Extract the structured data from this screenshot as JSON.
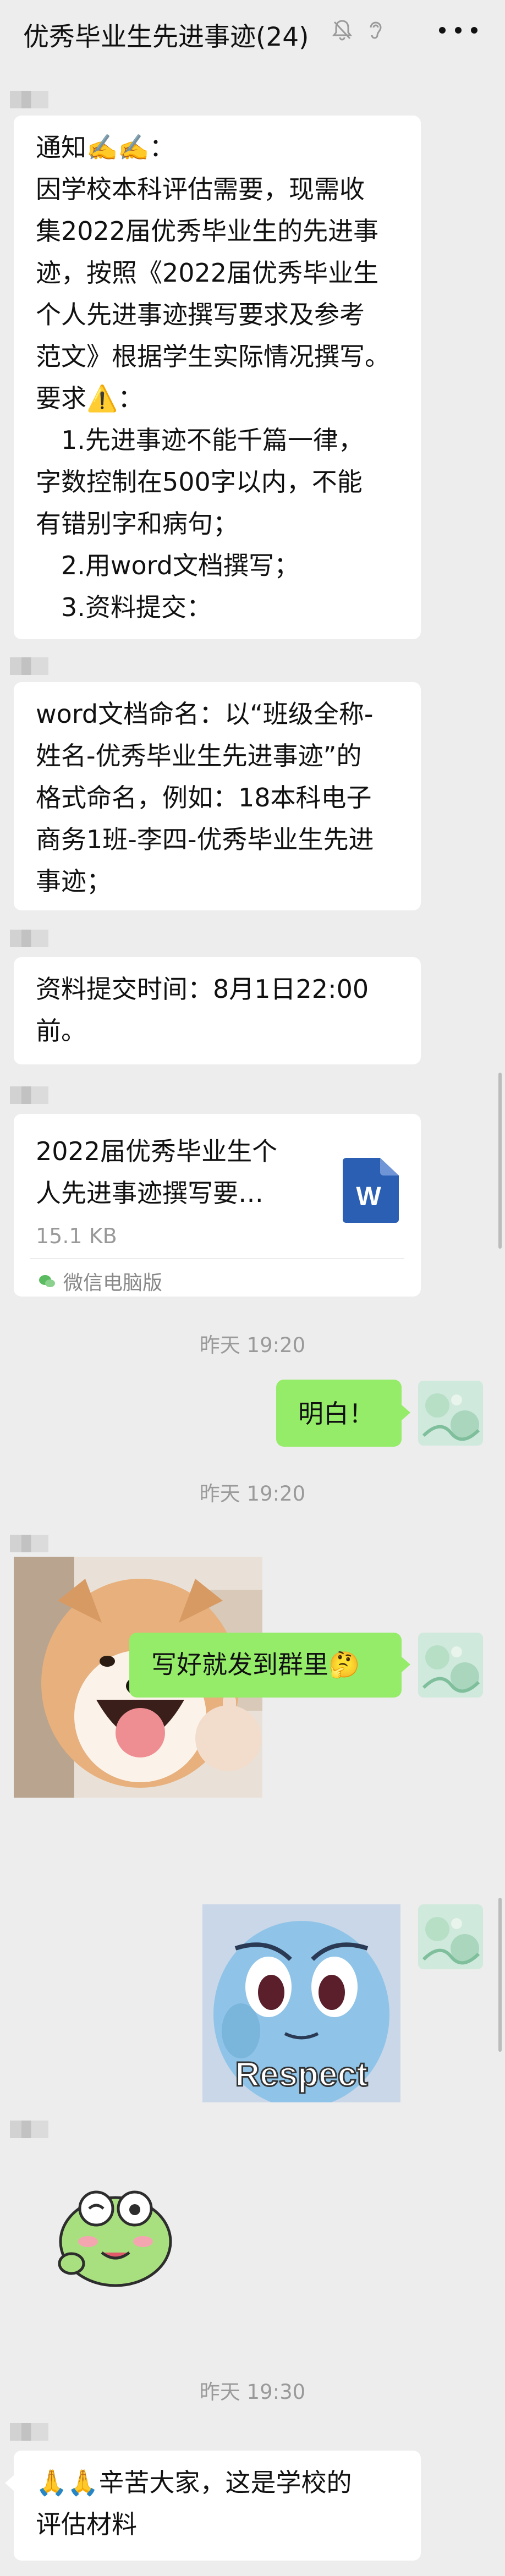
{
  "header": {
    "title": "优秀毕业生先进事迹(24)",
    "mute_icon": "bell-muted-icon",
    "ear_icon": "earpiece-icon",
    "more_icon": "more-dots-icon"
  },
  "messages": {
    "notice": {
      "line1": "通知✍️✍️：",
      "line2": "因学校本科评估需要，现需收",
      "line3": "集2022届优秀毕业生的先进事",
      "line4": "迹，按照《2022届优秀毕业生",
      "line5": "个人先进事迹撰写要求及参考",
      "line6": "范文》根据学生实际情况撰写。",
      "line7": "要求⚠️：",
      "line8": "1.先进事迹不能千篇一律，",
      "line9": "字数控制在500字以内，不能",
      "line10": "有错别字和病句；",
      "line11": "2.用word文档撰写；",
      "line12": "3.资料提交："
    },
    "naming": {
      "line1": "word文档命名：以“班级全称-",
      "line2": "姓名-优秀毕业生先进事迹”的",
      "line3": "格式命名，例如：18本科电子",
      "line4": "商务1班-李四-优秀毕业生先进",
      "line5": "事迹；"
    },
    "deadline": {
      "line1": "资料提交时间：8月1日22:00",
      "line2": "前。"
    },
    "file": {
      "name_line1": "2022届优秀毕业生个",
      "name_line2": "人先进事迹撰写要…",
      "size": "15.1 KB",
      "icon_letter": "W",
      "source": "微信电脑版"
    },
    "time1": "昨天 19:20",
    "reply1": "明白！",
    "time2": "昨天 19:20",
    "reply2": "写好就发到群里🤔",
    "sticker_caption": "Respect",
    "time3": "昨天 19:30",
    "last": {
      "line1": "🙏🙏辛苦大家，这是学校的",
      "line2": "评估材料"
    }
  },
  "colors": {
    "background": "#ededed",
    "my_bubble": "#95ec69",
    "other_bubble": "#ffffff",
    "word_icon": "#2b5fb4"
  }
}
